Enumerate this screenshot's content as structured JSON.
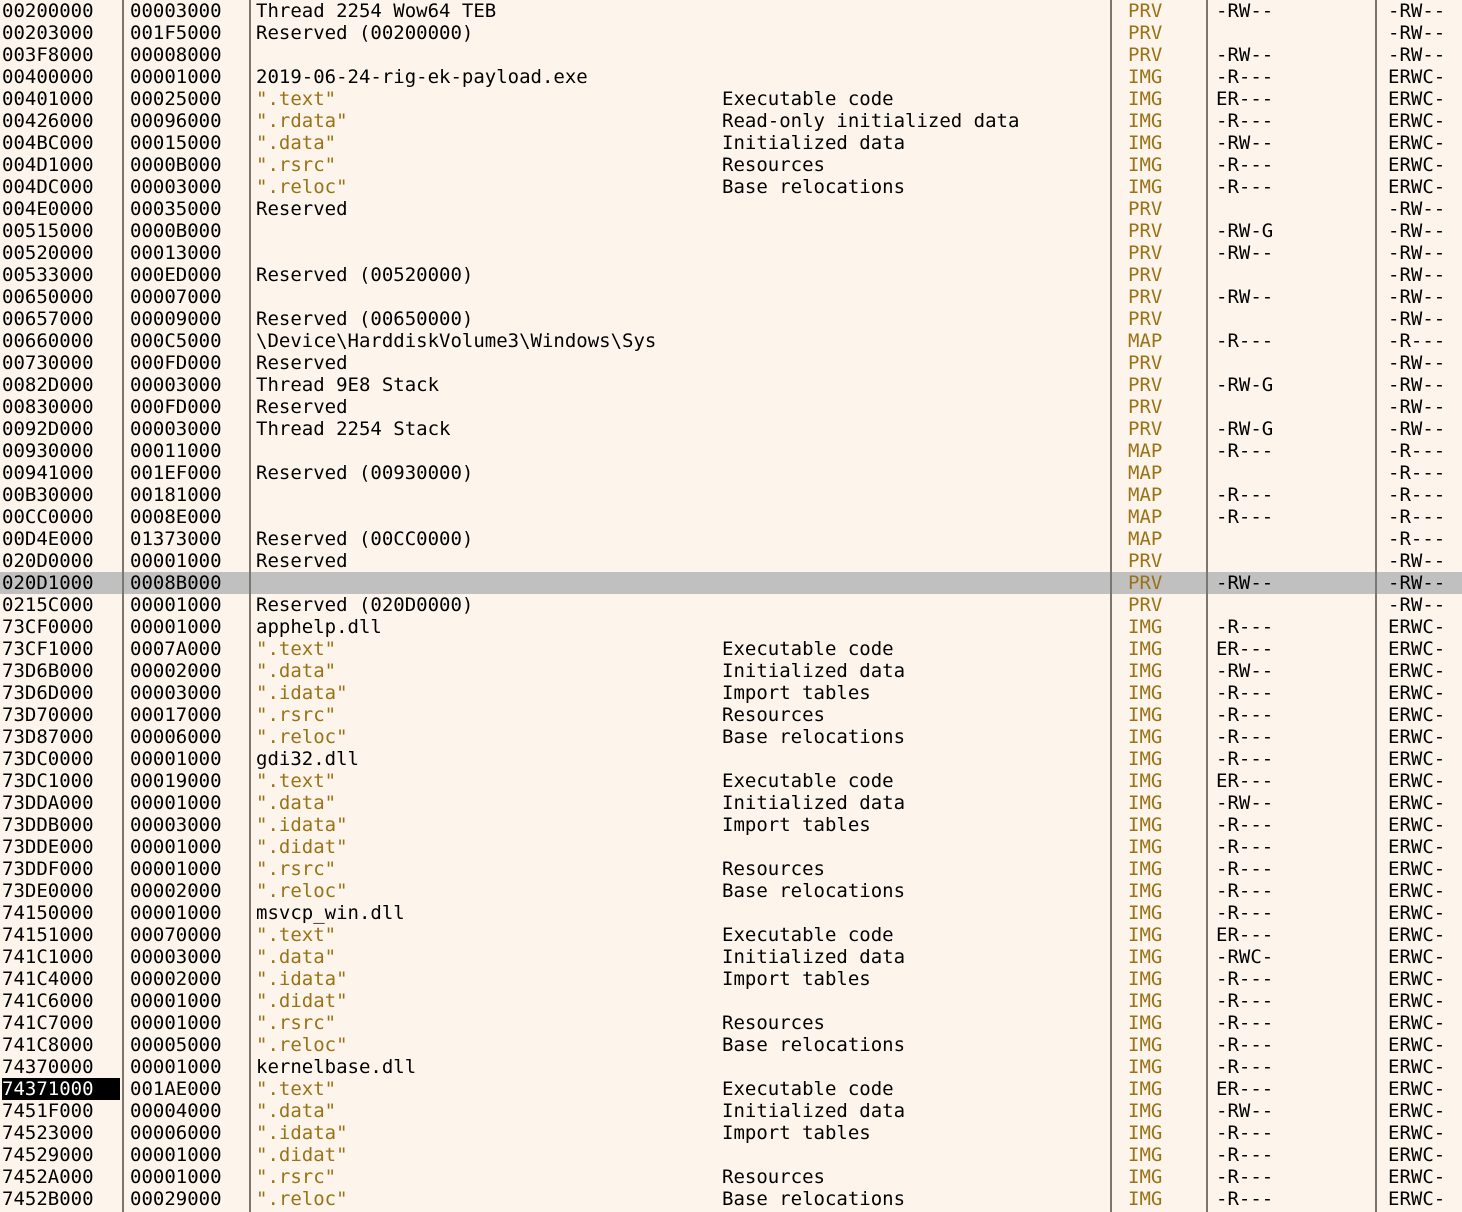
{
  "app": {
    "view_name": "memory-map",
    "colors": {
      "background": "#fdf5ec",
      "separator": "#7a7672",
      "selected_row": "#c0c0c0",
      "focus_cell_bg": "#000000",
      "focus_cell_fg": "#ffffff",
      "section_text": "#9a7216",
      "type_text": "#9a7216",
      "normal_text": "#000000"
    }
  },
  "columns": [
    {
      "key": "address",
      "name": "address-column"
    },
    {
      "key": "size",
      "name": "size-column"
    },
    {
      "key": "info",
      "name": "info-column"
    },
    {
      "key": "description",
      "name": "description-column"
    },
    {
      "key": "type",
      "name": "type-column"
    },
    {
      "key": "protection",
      "name": "protection-column"
    },
    {
      "key": "initial_protection",
      "name": "initial-protection-column"
    }
  ],
  "rows": [
    {
      "address": "00200000",
      "size": "00003000",
      "info": "Thread 2254 Wow64 TEB",
      "section": false,
      "description": "",
      "type": "PRV",
      "protection": "-RW--",
      "initial_protection": "-RW--",
      "selected": false,
      "focused": false
    },
    {
      "address": "00203000",
      "size": "001F5000",
      "info": "Reserved (00200000)",
      "section": false,
      "description": "",
      "type": "PRV",
      "protection": "",
      "initial_protection": "-RW--",
      "selected": false,
      "focused": false
    },
    {
      "address": "003F8000",
      "size": "00008000",
      "info": "",
      "section": false,
      "description": "",
      "type": "PRV",
      "protection": "-RW--",
      "initial_protection": "-RW--",
      "selected": false,
      "focused": false
    },
    {
      "address": "00400000",
      "size": "00001000",
      "info": "2019-06-24-rig-ek-payload.exe",
      "section": false,
      "description": "",
      "type": "IMG",
      "protection": "-R---",
      "initial_protection": "ERWC-",
      "selected": false,
      "focused": false
    },
    {
      "address": "00401000",
      "size": "00025000",
      "info": "\".text\"",
      "section": true,
      "description": "Executable code",
      "type": "IMG",
      "protection": "ER---",
      "initial_protection": "ERWC-",
      "selected": false,
      "focused": false
    },
    {
      "address": "00426000",
      "size": "00096000",
      "info": "\".rdata\"",
      "section": true,
      "description": "Read-only initialized data",
      "type": "IMG",
      "protection": "-R---",
      "initial_protection": "ERWC-",
      "selected": false,
      "focused": false
    },
    {
      "address": "004BC000",
      "size": "00015000",
      "info": "\".data\"",
      "section": true,
      "description": "Initialized data",
      "type": "IMG",
      "protection": "-RW--",
      "initial_protection": "ERWC-",
      "selected": false,
      "focused": false
    },
    {
      "address": "004D1000",
      "size": "0000B000",
      "info": "\".rsrc\"",
      "section": true,
      "description": "Resources",
      "type": "IMG",
      "protection": "-R---",
      "initial_protection": "ERWC-",
      "selected": false,
      "focused": false
    },
    {
      "address": "004DC000",
      "size": "00003000",
      "info": "\".reloc\"",
      "section": true,
      "description": "Base relocations",
      "type": "IMG",
      "protection": "-R---",
      "initial_protection": "ERWC-",
      "selected": false,
      "focused": false
    },
    {
      "address": "004E0000",
      "size": "00035000",
      "info": "Reserved",
      "section": false,
      "description": "",
      "type": "PRV",
      "protection": "",
      "initial_protection": "-RW--",
      "selected": false,
      "focused": false
    },
    {
      "address": "00515000",
      "size": "0000B000",
      "info": "",
      "section": false,
      "description": "",
      "type": "PRV",
      "protection": "-RW-G",
      "initial_protection": "-RW--",
      "selected": false,
      "focused": false
    },
    {
      "address": "00520000",
      "size": "00013000",
      "info": "",
      "section": false,
      "description": "",
      "type": "PRV",
      "protection": "-RW--",
      "initial_protection": "-RW--",
      "selected": false,
      "focused": false
    },
    {
      "address": "00533000",
      "size": "000ED000",
      "info": "Reserved (00520000)",
      "section": false,
      "description": "",
      "type": "PRV",
      "protection": "",
      "initial_protection": "-RW--",
      "selected": false,
      "focused": false
    },
    {
      "address": "00650000",
      "size": "00007000",
      "info": "",
      "section": false,
      "description": "",
      "type": "PRV",
      "protection": "-RW--",
      "initial_protection": "-RW--",
      "selected": false,
      "focused": false
    },
    {
      "address": "00657000",
      "size": "00009000",
      "info": "Reserved (00650000)",
      "section": false,
      "description": "",
      "type": "PRV",
      "protection": "",
      "initial_protection": "-RW--",
      "selected": false,
      "focused": false
    },
    {
      "address": "00660000",
      "size": "000C5000",
      "info": "\\Device\\HarddiskVolume3\\Windows\\Sys",
      "section": false,
      "description": "",
      "type": "MAP",
      "protection": "-R---",
      "initial_protection": "-R---",
      "selected": false,
      "focused": false
    },
    {
      "address": "00730000",
      "size": "000FD000",
      "info": "Reserved",
      "section": false,
      "description": "",
      "type": "PRV",
      "protection": "",
      "initial_protection": "-RW--",
      "selected": false,
      "focused": false
    },
    {
      "address": "0082D000",
      "size": "00003000",
      "info": "Thread 9E8 Stack",
      "section": false,
      "description": "",
      "type": "PRV",
      "protection": "-RW-G",
      "initial_protection": "-RW--",
      "selected": false,
      "focused": false
    },
    {
      "address": "00830000",
      "size": "000FD000",
      "info": "Reserved",
      "section": false,
      "description": "",
      "type": "PRV",
      "protection": "",
      "initial_protection": "-RW--",
      "selected": false,
      "focused": false
    },
    {
      "address": "0092D000",
      "size": "00003000",
      "info": "Thread 2254 Stack",
      "section": false,
      "description": "",
      "type": "PRV",
      "protection": "-RW-G",
      "initial_protection": "-RW--",
      "selected": false,
      "focused": false
    },
    {
      "address": "00930000",
      "size": "00011000",
      "info": "",
      "section": false,
      "description": "",
      "type": "MAP",
      "protection": "-R---",
      "initial_protection": "-R---",
      "selected": false,
      "focused": false
    },
    {
      "address": "00941000",
      "size": "001EF000",
      "info": "Reserved (00930000)",
      "section": false,
      "description": "",
      "type": "MAP",
      "protection": "",
      "initial_protection": "-R---",
      "selected": false,
      "focused": false
    },
    {
      "address": "00B30000",
      "size": "00181000",
      "info": "",
      "section": false,
      "description": "",
      "type": "MAP",
      "protection": "-R---",
      "initial_protection": "-R---",
      "selected": false,
      "focused": false
    },
    {
      "address": "00CC0000",
      "size": "0008E000",
      "info": "",
      "section": false,
      "description": "",
      "type": "MAP",
      "protection": "-R---",
      "initial_protection": "-R---",
      "selected": false,
      "focused": false
    },
    {
      "address": "00D4E000",
      "size": "01373000",
      "info": "Reserved (00CC0000)",
      "section": false,
      "description": "",
      "type": "MAP",
      "protection": "",
      "initial_protection": "-R---",
      "selected": false,
      "focused": false
    },
    {
      "address": "020D0000",
      "size": "00001000",
      "info": "Reserved",
      "section": false,
      "description": "",
      "type": "PRV",
      "protection": "",
      "initial_protection": "-RW--",
      "selected": false,
      "focused": false
    },
    {
      "address": "020D1000",
      "size": "0008B000",
      "info": "",
      "section": false,
      "description": "",
      "type": "PRV",
      "protection": "-RW--",
      "initial_protection": "-RW--",
      "selected": true,
      "focused": false
    },
    {
      "address": "0215C000",
      "size": "00001000",
      "info": "Reserved (020D0000)",
      "section": false,
      "description": "",
      "type": "PRV",
      "protection": "",
      "initial_protection": "-RW--",
      "selected": false,
      "focused": false
    },
    {
      "address": "73CF0000",
      "size": "00001000",
      "info": "apphelp.dll",
      "section": false,
      "description": "",
      "type": "IMG",
      "protection": "-R---",
      "initial_protection": "ERWC-",
      "selected": false,
      "focused": false
    },
    {
      "address": "73CF1000",
      "size": "0007A000",
      "info": "\".text\"",
      "section": true,
      "description": "Executable code",
      "type": "IMG",
      "protection": "ER---",
      "initial_protection": "ERWC-",
      "selected": false,
      "focused": false
    },
    {
      "address": "73D6B000",
      "size": "00002000",
      "info": "\".data\"",
      "section": true,
      "description": "Initialized data",
      "type": "IMG",
      "protection": "-RW--",
      "initial_protection": "ERWC-",
      "selected": false,
      "focused": false
    },
    {
      "address": "73D6D000",
      "size": "00003000",
      "info": "\".idata\"",
      "section": true,
      "description": "Import tables",
      "type": "IMG",
      "protection": "-R---",
      "initial_protection": "ERWC-",
      "selected": false,
      "focused": false
    },
    {
      "address": "73D70000",
      "size": "00017000",
      "info": "\".rsrc\"",
      "section": true,
      "description": "Resources",
      "type": "IMG",
      "protection": "-R---",
      "initial_protection": "ERWC-",
      "selected": false,
      "focused": false
    },
    {
      "address": "73D87000",
      "size": "00006000",
      "info": "\".reloc\"",
      "section": true,
      "description": "Base relocations",
      "type": "IMG",
      "protection": "-R---",
      "initial_protection": "ERWC-",
      "selected": false,
      "focused": false
    },
    {
      "address": "73DC0000",
      "size": "00001000",
      "info": "gdi32.dll",
      "section": false,
      "description": "",
      "type": "IMG",
      "protection": "-R---",
      "initial_protection": "ERWC-",
      "selected": false,
      "focused": false
    },
    {
      "address": "73DC1000",
      "size": "00019000",
      "info": "\".text\"",
      "section": true,
      "description": "Executable code",
      "type": "IMG",
      "protection": "ER---",
      "initial_protection": "ERWC-",
      "selected": false,
      "focused": false
    },
    {
      "address": "73DDA000",
      "size": "00001000",
      "info": "\".data\"",
      "section": true,
      "description": "Initialized data",
      "type": "IMG",
      "protection": "-RW--",
      "initial_protection": "ERWC-",
      "selected": false,
      "focused": false
    },
    {
      "address": "73DDB000",
      "size": "00003000",
      "info": "\".idata\"",
      "section": true,
      "description": "Import tables",
      "type": "IMG",
      "protection": "-R---",
      "initial_protection": "ERWC-",
      "selected": false,
      "focused": false
    },
    {
      "address": "73DDE000",
      "size": "00001000",
      "info": "\".didat\"",
      "section": true,
      "description": "",
      "type": "IMG",
      "protection": "-R---",
      "initial_protection": "ERWC-",
      "selected": false,
      "focused": false
    },
    {
      "address": "73DDF000",
      "size": "00001000",
      "info": "\".rsrc\"",
      "section": true,
      "description": "Resources",
      "type": "IMG",
      "protection": "-R---",
      "initial_protection": "ERWC-",
      "selected": false,
      "focused": false
    },
    {
      "address": "73DE0000",
      "size": "00002000",
      "info": "\".reloc\"",
      "section": true,
      "description": "Base relocations",
      "type": "IMG",
      "protection": "-R---",
      "initial_protection": "ERWC-",
      "selected": false,
      "focused": false
    },
    {
      "address": "74150000",
      "size": "00001000",
      "info": "msvcp_win.dll",
      "section": false,
      "description": "",
      "type": "IMG",
      "protection": "-R---",
      "initial_protection": "ERWC-",
      "selected": false,
      "focused": false
    },
    {
      "address": "74151000",
      "size": "00070000",
      "info": "\".text\"",
      "section": true,
      "description": "Executable code",
      "type": "IMG",
      "protection": "ER---",
      "initial_protection": "ERWC-",
      "selected": false,
      "focused": false
    },
    {
      "address": "741C1000",
      "size": "00003000",
      "info": "\".data\"",
      "section": true,
      "description": "Initialized data",
      "type": "IMG",
      "protection": "-RWC-",
      "initial_protection": "ERWC-",
      "selected": false,
      "focused": false
    },
    {
      "address": "741C4000",
      "size": "00002000",
      "info": "\".idata\"",
      "section": true,
      "description": "Import tables",
      "type": "IMG",
      "protection": "-R---",
      "initial_protection": "ERWC-",
      "selected": false,
      "focused": false
    },
    {
      "address": "741C6000",
      "size": "00001000",
      "info": "\".didat\"",
      "section": true,
      "description": "",
      "type": "IMG",
      "protection": "-R---",
      "initial_protection": "ERWC-",
      "selected": false,
      "focused": false
    },
    {
      "address": "741C7000",
      "size": "00001000",
      "info": "\".rsrc\"",
      "section": true,
      "description": "Resources",
      "type": "IMG",
      "protection": "-R---",
      "initial_protection": "ERWC-",
      "selected": false,
      "focused": false
    },
    {
      "address": "741C8000",
      "size": "00005000",
      "info": "\".reloc\"",
      "section": true,
      "description": "Base relocations",
      "type": "IMG",
      "protection": "-R---",
      "initial_protection": "ERWC-",
      "selected": false,
      "focused": false
    },
    {
      "address": "74370000",
      "size": "00001000",
      "info": "kernelbase.dll",
      "section": false,
      "description": "",
      "type": "IMG",
      "protection": "-R---",
      "initial_protection": "ERWC-",
      "selected": false,
      "focused": false
    },
    {
      "address": "74371000",
      "size": "001AE000",
      "info": "\".text\"",
      "section": true,
      "description": "Executable code",
      "type": "IMG",
      "protection": "ER---",
      "initial_protection": "ERWC-",
      "selected": false,
      "focused": true
    },
    {
      "address": "7451F000",
      "size": "00004000",
      "info": "\".data\"",
      "section": true,
      "description": "Initialized data",
      "type": "IMG",
      "protection": "-RW--",
      "initial_protection": "ERWC-",
      "selected": false,
      "focused": false
    },
    {
      "address": "74523000",
      "size": "00006000",
      "info": "\".idata\"",
      "section": true,
      "description": "Import tables",
      "type": "IMG",
      "protection": "-R---",
      "initial_protection": "ERWC-",
      "selected": false,
      "focused": false
    },
    {
      "address": "74529000",
      "size": "00001000",
      "info": "\".didat\"",
      "section": true,
      "description": "",
      "type": "IMG",
      "protection": "-R---",
      "initial_protection": "ERWC-",
      "selected": false,
      "focused": false
    },
    {
      "address": "7452A000",
      "size": "00001000",
      "info": "\".rsrc\"",
      "section": true,
      "description": "Resources",
      "type": "IMG",
      "protection": "-R---",
      "initial_protection": "ERWC-",
      "selected": false,
      "focused": false
    },
    {
      "address": "7452B000",
      "size": "00029000",
      "info": "\".reloc\"",
      "section": true,
      "description": "Base relocations",
      "type": "IMG",
      "protection": "-R---",
      "initial_protection": "ERWC-",
      "selected": false,
      "focused": false
    }
  ]
}
